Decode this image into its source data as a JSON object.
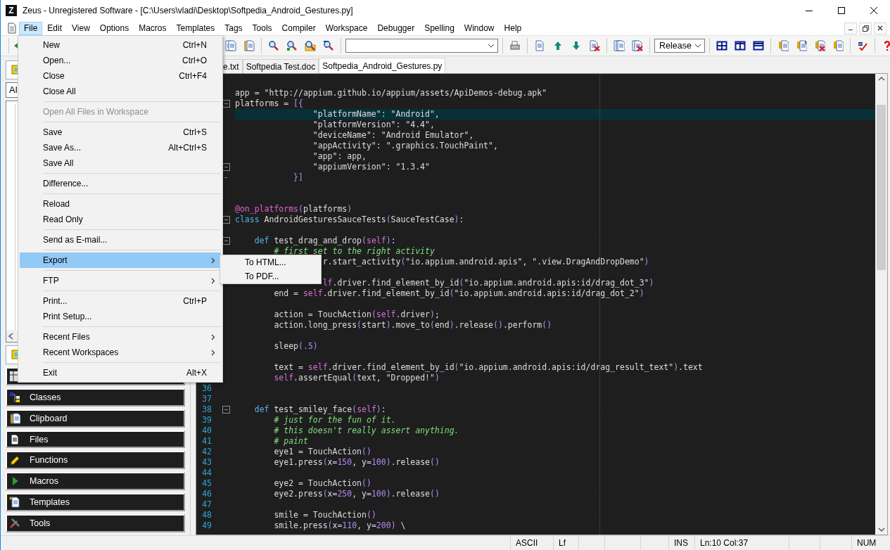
{
  "window": {
    "icon_letter": "Z",
    "title": "Zeus - Unregistered Software - [C:\\Users\\vladi\\Desktop\\Softpedia_Android_Gestures.py]"
  },
  "menu_bar": [
    {
      "label": "File",
      "selected": true
    },
    {
      "label": "Edit",
      "selected": false
    },
    {
      "label": "View",
      "selected": false
    },
    {
      "label": "Options",
      "selected": false
    },
    {
      "label": "Macros",
      "selected": false
    },
    {
      "label": "Templates",
      "selected": false
    },
    {
      "label": "Tags",
      "selected": false
    },
    {
      "label": "Tools",
      "selected": false
    },
    {
      "label": "Compiler",
      "selected": false
    },
    {
      "label": "Workspace",
      "selected": false
    },
    {
      "label": "Debugger",
      "selected": false
    },
    {
      "label": "Spelling",
      "selected": false
    },
    {
      "label": "Window",
      "selected": false
    },
    {
      "label": "Help",
      "selected": false
    }
  ],
  "toolbar": {
    "build_config": "Release"
  },
  "left_panel": {
    "filter": "Al",
    "buttons": [
      {
        "kind": "covered"
      },
      {
        "kind": "labelled",
        "label": "Classes"
      },
      {
        "kind": "labelled",
        "label": "Clipboard"
      },
      {
        "kind": "labelled",
        "label": "Files"
      },
      {
        "kind": "labelled",
        "label": "Functions"
      },
      {
        "kind": "labelled",
        "label": "Macros"
      },
      {
        "kind": "labelled",
        "label": "Templates"
      },
      {
        "kind": "labelled",
        "label": "Tools"
      }
    ]
  },
  "tabs": [
    {
      "label": "e.txt",
      "selected": false
    },
    {
      "label": "Softpedia Test.doc",
      "selected": false
    },
    {
      "label": "Softpedia_Android_Gestures.py",
      "selected": true
    }
  ],
  "editor": {
    "lines": [
      {
        "kind": "code",
        "highlighted": false,
        "segments": [
          {
            "kind": "plain",
            "text": "app = \"http://appium.github.io/appium/assets/ApiDemos-debug.apk\""
          }
        ]
      },
      {
        "kind": "fold-start",
        "highlighted": false,
        "segments": [
          {
            "kind": "plain",
            "text": "platforms = "
          },
          {
            "kind": "bracket",
            "text": "[{"
          }
        ]
      },
      {
        "kind": "code",
        "highlighted": true,
        "segments": [
          {
            "kind": "plain",
            "text": "                \"platformName\": \"Android\","
          }
        ]
      },
      {
        "kind": "code",
        "highlighted": false,
        "segments": [
          {
            "kind": "plain",
            "text": "                \"platformVersion\": \"4.4\","
          }
        ]
      },
      {
        "kind": "code",
        "highlighted": false,
        "segments": [
          {
            "kind": "plain",
            "text": "                \"deviceName\": \"Android Emulator\","
          }
        ]
      },
      {
        "kind": "code",
        "highlighted": false,
        "segments": [
          {
            "kind": "plain",
            "text": "                \"appActivity\": \".graphics.TouchPaint\","
          }
        ]
      },
      {
        "kind": "code",
        "highlighted": false,
        "segments": [
          {
            "kind": "plain",
            "text": "                \"app\": app,"
          }
        ]
      },
      {
        "kind": "fold-start",
        "highlighted": false,
        "segments": [
          {
            "kind": "plain",
            "text": "                \"appiumVersion\": \"1.3.4\""
          }
        ]
      },
      {
        "kind": "fold-end",
        "highlighted": false,
        "segments": [
          {
            "kind": "bracket",
            "text": "            }]"
          }
        ]
      },
      {
        "kind": "code",
        "highlighted": false
      },
      {
        "kind": "code",
        "highlighted": false
      },
      {
        "kind": "code",
        "highlighted": false,
        "segments": [
          {
            "kind": "decorator",
            "text": "@on_platforms"
          },
          {
            "kind": "bracket",
            "text": "("
          },
          {
            "kind": "plain",
            "text": "platforms"
          },
          {
            "kind": "bracket",
            "text": ")"
          }
        ]
      },
      {
        "kind": "fold-start",
        "highlighted": false,
        "segments": [
          {
            "kind": "keyword",
            "text": "class"
          },
          {
            "kind": "plain",
            "text": " AndroidGesturesSauceTests"
          },
          {
            "kind": "bracket",
            "text": "("
          },
          {
            "kind": "plain",
            "text": "SauceTestCase"
          },
          {
            "kind": "bracket",
            "text": ")"
          },
          {
            "kind": "plain",
            "text": ":"
          }
        ]
      },
      {
        "kind": "code",
        "highlighted": false
      },
      {
        "kind": "fold-start",
        "highlighted": false,
        "segments": [
          {
            "kind": "keyword",
            "text": "    def"
          },
          {
            "kind": "plain",
            "text": " test_drag_and_drop"
          },
          {
            "kind": "bracket",
            "text": "("
          },
          {
            "kind": "self",
            "text": "self"
          },
          {
            "kind": "bracket",
            "text": ")"
          },
          {
            "kind": "plain",
            "text": ":"
          }
        ]
      },
      {
        "kind": "code",
        "highlighted": false,
        "segments": [
          {
            "kind": "comment",
            "text": "        # first set to the right activity"
          }
        ]
      },
      {
        "kind": "code",
        "highlighted": false,
        "segments": [
          {
            "kind": "plain",
            "text": "                  r.start_activity"
          },
          {
            "kind": "bracket",
            "text": "("
          },
          {
            "kind": "plain",
            "text": "\"io.appium.android.apis\", \".view.DragAndDropDemo\""
          },
          {
            "kind": "bracket",
            "text": ")"
          }
        ]
      },
      {
        "kind": "code",
        "highlighted": false
      },
      {
        "kind": "code",
        "highlighted": false,
        "segments": [
          {
            "kind": "self",
            "text": "                  lf"
          },
          {
            "kind": "plain",
            "text": ".driver.find_element_by_id"
          },
          {
            "kind": "bracket",
            "text": "("
          },
          {
            "kind": "plain",
            "text": "\"io.appium.android.apis:id/drag_dot_3\""
          },
          {
            "kind": "bracket",
            "text": ")"
          }
        ]
      },
      {
        "kind": "code",
        "highlighted": false,
        "segments": [
          {
            "kind": "plain",
            "text": "        end = "
          },
          {
            "kind": "self",
            "text": "self"
          },
          {
            "kind": "plain",
            "text": ".driver.find_element_by_id"
          },
          {
            "kind": "bracket",
            "text": "("
          },
          {
            "kind": "plain",
            "text": "\"io.appium.android.apis:id/drag_dot_2\""
          },
          {
            "kind": "bracket",
            "text": ")"
          }
        ]
      },
      {
        "kind": "code",
        "highlighted": false
      },
      {
        "kind": "code",
        "highlighted": false,
        "segments": [
          {
            "kind": "plain",
            "text": "        action = TouchAction"
          },
          {
            "kind": "bracket",
            "text": "("
          },
          {
            "kind": "self",
            "text": "self"
          },
          {
            "kind": "plain",
            "text": ".driver"
          },
          {
            "kind": "bracket",
            "text": ")"
          },
          {
            "kind": "plain",
            "text": ";"
          }
        ]
      },
      {
        "kind": "code",
        "highlighted": false,
        "segments": [
          {
            "kind": "plain",
            "text": "        action.long_press"
          },
          {
            "kind": "bracket",
            "text": "("
          },
          {
            "kind": "plain",
            "text": "start"
          },
          {
            "kind": "bracket",
            "text": ")"
          },
          {
            "kind": "plain",
            "text": ".move_to"
          },
          {
            "kind": "bracket",
            "text": "("
          },
          {
            "kind": "plain",
            "text": "end"
          },
          {
            "kind": "bracket",
            "text": ")"
          },
          {
            "kind": "plain",
            "text": ".release"
          },
          {
            "kind": "bracket",
            "text": "()"
          },
          {
            "kind": "plain",
            "text": ".perform"
          },
          {
            "kind": "bracket",
            "text": "()"
          }
        ]
      },
      {
        "kind": "code",
        "highlighted": false
      },
      {
        "kind": "code",
        "highlighted": false,
        "segments": [
          {
            "kind": "plain",
            "text": "        sleep"
          },
          {
            "kind": "bracket",
            "text": "("
          },
          {
            "kind": "number",
            "text": ".5"
          },
          {
            "kind": "bracket",
            "text": ")"
          }
        ]
      },
      {
        "kind": "code",
        "highlighted": false
      },
      {
        "kind": "code",
        "highlighted": false,
        "segments": [
          {
            "kind": "plain",
            "text": "        text = "
          },
          {
            "kind": "self",
            "text": "self"
          },
          {
            "kind": "plain",
            "text": ".driver.find_element_by_id"
          },
          {
            "kind": "bracket",
            "text": "("
          },
          {
            "kind": "plain",
            "text": "\"io.appium.android.apis:id/drag_result_text\""
          },
          {
            "kind": "bracket",
            "text": ")"
          },
          {
            "kind": "plain",
            "text": ".text"
          }
        ]
      },
      {
        "kind": "code",
        "highlighted": false,
        "segments": [
          {
            "kind": "self",
            "text": "        self"
          },
          {
            "kind": "plain",
            "text": ".assertEqual"
          },
          {
            "kind": "bracket",
            "text": "("
          },
          {
            "kind": "plain",
            "text": "text, \"Dropped!\""
          },
          {
            "kind": "bracket",
            "text": ")"
          }
        ]
      },
      {
        "kind": "code",
        "highlighted": false,
        "number": "36"
      },
      {
        "kind": "code",
        "highlighted": false,
        "number": "37"
      },
      {
        "kind": "fold-start",
        "highlighted": false,
        "number": "38",
        "segments": [
          {
            "kind": "keyword",
            "text": "    def"
          },
          {
            "kind": "plain",
            "text": " test_smiley_face"
          },
          {
            "kind": "bracket",
            "text": "("
          },
          {
            "kind": "self",
            "text": "self"
          },
          {
            "kind": "bracket",
            "text": ")"
          },
          {
            "kind": "plain",
            "text": ":"
          }
        ]
      },
      {
        "kind": "code",
        "highlighted": false,
        "number": "39",
        "segments": [
          {
            "kind": "comment",
            "text": "        # just for the fun of it."
          }
        ]
      },
      {
        "kind": "code",
        "highlighted": false,
        "number": "40",
        "segments": [
          {
            "kind": "comment",
            "text": "        # this doesn't really assert anything."
          }
        ]
      },
      {
        "kind": "code",
        "highlighted": false,
        "number": "41",
        "segments": [
          {
            "kind": "comment",
            "text": "        # paint"
          }
        ]
      },
      {
        "kind": "code",
        "highlighted": false,
        "number": "42",
        "segments": [
          {
            "kind": "plain",
            "text": "        eye1 = TouchAction"
          },
          {
            "kind": "bracket",
            "text": "()"
          }
        ]
      },
      {
        "kind": "code",
        "highlighted": false,
        "number": "43",
        "segments": [
          {
            "kind": "plain",
            "text": "        eye1.press"
          },
          {
            "kind": "bracket",
            "text": "("
          },
          {
            "kind": "plain",
            "text": "x="
          },
          {
            "kind": "number",
            "text": "150"
          },
          {
            "kind": "plain",
            "text": ", y="
          },
          {
            "kind": "number",
            "text": "100"
          },
          {
            "kind": "bracket",
            "text": ")"
          },
          {
            "kind": "plain",
            "text": ".release"
          },
          {
            "kind": "bracket",
            "text": "()"
          }
        ]
      },
      {
        "kind": "code",
        "highlighted": false,
        "number": "44"
      },
      {
        "kind": "code",
        "highlighted": false,
        "number": "45",
        "segments": [
          {
            "kind": "plain",
            "text": "        eye2 = TouchAction"
          },
          {
            "kind": "bracket",
            "text": "()"
          }
        ]
      },
      {
        "kind": "code",
        "highlighted": false,
        "number": "46",
        "segments": [
          {
            "kind": "plain",
            "text": "        eye2.press"
          },
          {
            "kind": "bracket",
            "text": "("
          },
          {
            "kind": "plain",
            "text": "x="
          },
          {
            "kind": "number",
            "text": "250"
          },
          {
            "kind": "plain",
            "text": ", y="
          },
          {
            "kind": "number",
            "text": "100"
          },
          {
            "kind": "bracket",
            "text": ")"
          },
          {
            "kind": "plain",
            "text": ".release"
          },
          {
            "kind": "bracket",
            "text": "()"
          }
        ]
      },
      {
        "kind": "code",
        "highlighted": false,
        "number": "47"
      },
      {
        "kind": "code",
        "highlighted": false,
        "number": "48",
        "segments": [
          {
            "kind": "plain",
            "text": "        smile = TouchAction"
          },
          {
            "kind": "bracket",
            "text": "()"
          }
        ]
      },
      {
        "kind": "code",
        "highlighted": false,
        "number": "49",
        "segments": [
          {
            "kind": "plain",
            "text": "        smile.press"
          },
          {
            "kind": "bracket",
            "text": "("
          },
          {
            "kind": "plain",
            "text": "x="
          },
          {
            "kind": "number",
            "text": "110"
          },
          {
            "kind": "plain",
            "text": ", y="
          },
          {
            "kind": "number",
            "text": "200"
          },
          {
            "kind": "bracket",
            "text": ")"
          },
          {
            "kind": "plain",
            "text": " \\"
          }
        ]
      }
    ]
  },
  "file_menu": [
    {
      "kind": "item",
      "label": "New",
      "shortcut": "Ctrl+N",
      "disabled": false,
      "selected": false,
      "submenu": false
    },
    {
      "kind": "item",
      "label": "Open...",
      "shortcut": "Ctrl+O",
      "disabled": false,
      "selected": false,
      "submenu": false
    },
    {
      "kind": "item",
      "label": "Close",
      "shortcut": "Ctrl+F4",
      "disabled": false,
      "selected": false,
      "submenu": false
    },
    {
      "kind": "item",
      "label": "Close All",
      "disabled": false,
      "selected": false,
      "submenu": false
    },
    {
      "kind": "separator"
    },
    {
      "kind": "item",
      "label": "Open All Files in Workspace",
      "disabled": true,
      "selected": false,
      "submenu": false
    },
    {
      "kind": "separator"
    },
    {
      "kind": "item",
      "label": "Save",
      "shortcut": "Ctrl+S",
      "disabled": false,
      "selected": false,
      "submenu": false
    },
    {
      "kind": "item",
      "label": "Save As...",
      "shortcut": "Alt+Ctrl+S",
      "disabled": false,
      "selected": false,
      "submenu": false
    },
    {
      "kind": "item",
      "label": "Save All",
      "disabled": false,
      "selected": false,
      "submenu": false
    },
    {
      "kind": "separator"
    },
    {
      "kind": "item",
      "label": "Difference...",
      "disabled": false,
      "selected": false,
      "submenu": false
    },
    {
      "kind": "separator"
    },
    {
      "kind": "item",
      "label": "Reload",
      "disabled": false,
      "selected": false,
      "submenu": false
    },
    {
      "kind": "item",
      "label": "Read Only",
      "disabled": false,
      "selected": false,
      "submenu": false
    },
    {
      "kind": "separator"
    },
    {
      "kind": "item",
      "label": "Send as E-mail...",
      "disabled": false,
      "selected": false,
      "submenu": false
    },
    {
      "kind": "separator"
    },
    {
      "kind": "item",
      "label": "Export",
      "disabled": false,
      "selected": true,
      "submenu": true
    },
    {
      "kind": "separator"
    },
    {
      "kind": "item",
      "label": "FTP",
      "disabled": false,
      "selected": false,
      "submenu": true
    },
    {
      "kind": "separator"
    },
    {
      "kind": "item",
      "label": "Print...",
      "shortcut": "Ctrl+P",
      "disabled": false,
      "selected": false,
      "submenu": false
    },
    {
      "kind": "item",
      "label": "Print Setup...",
      "disabled": false,
      "selected": false,
      "submenu": false
    },
    {
      "kind": "separator"
    },
    {
      "kind": "item",
      "label": "Recent Files",
      "disabled": false,
      "selected": false,
      "submenu": true
    },
    {
      "kind": "item",
      "label": "Recent Workspaces",
      "disabled": false,
      "selected": false,
      "submenu": true
    },
    {
      "kind": "separator"
    },
    {
      "kind": "item",
      "label": "Exit",
      "shortcut": "Alt+X",
      "disabled": false,
      "selected": false,
      "submenu": false
    }
  ],
  "export_submenu": [
    {
      "label": "To HTML..."
    },
    {
      "label": "To PDF..."
    }
  ],
  "status_bar": [
    {
      "kind": "blank"
    },
    {
      "kind": "text",
      "text": "ASCII"
    },
    {
      "kind": "text",
      "text": "Lf"
    },
    {
      "kind": "blank"
    },
    {
      "kind": "blank"
    },
    {
      "kind": "blank"
    },
    {
      "kind": "text",
      "text": "INS"
    },
    {
      "kind": "text",
      "text": "Ln:10 Col:37"
    },
    {
      "kind": "blank"
    },
    {
      "kind": "blank"
    },
    {
      "kind": "text",
      "text": "NUM"
    }
  ]
}
